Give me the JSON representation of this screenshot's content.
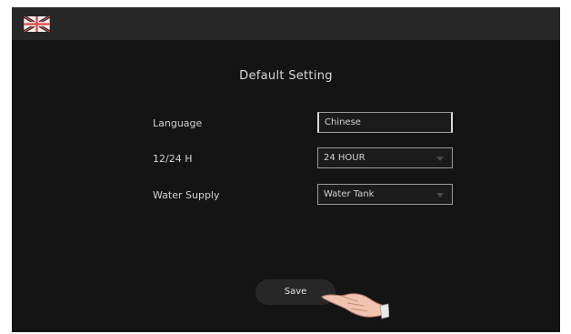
{
  "header": {
    "flag_icon": "uk-flag-icon"
  },
  "page": {
    "title": "Default Setting"
  },
  "settings": [
    {
      "label": "Language",
      "value": "Chinese"
    },
    {
      "label": "12/24 H",
      "value": "24 HOUR"
    },
    {
      "label": "Water Supply",
      "value": "Water Tank"
    }
  ],
  "actions": {
    "save_label": "Save"
  },
  "colors": {
    "background": "#141414",
    "topbar": "#272727",
    "text": "#d2d2d2"
  }
}
